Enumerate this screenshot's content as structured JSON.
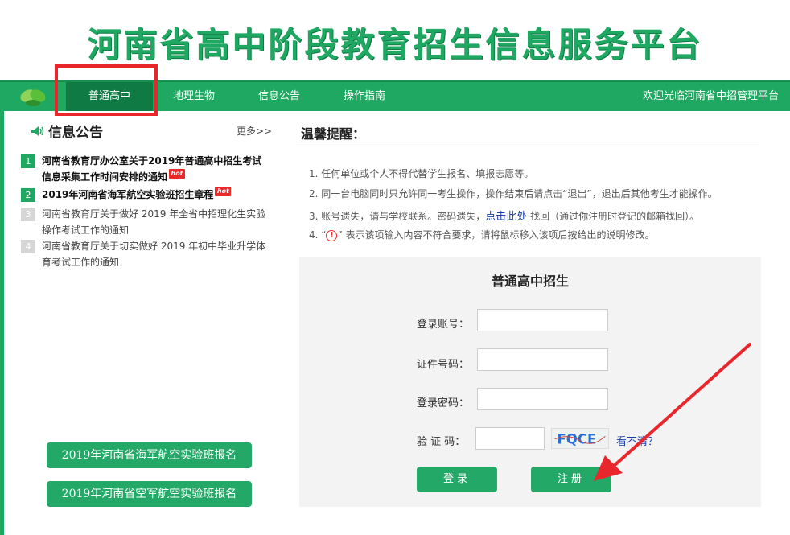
{
  "banner": {
    "title": "河南省高中阶段教育招生信息服务平台"
  },
  "nav": {
    "items": [
      {
        "label": "普通高中"
      },
      {
        "label": "地理生物"
      },
      {
        "label": "信息公告"
      },
      {
        "label": "操作指南"
      }
    ],
    "welcome": "欢迎光临河南省中招管理平台"
  },
  "news": {
    "title": "信息公告",
    "more": "更多>>",
    "hot_badge": "hot",
    "items": [
      {
        "num": "1",
        "text": "河南省教育厅办公室关于2019年普通高中招生考试信息采集工作时间安排的通知"
      },
      {
        "num": "2",
        "text": "2019年河南省海军航空实验班招生章程"
      },
      {
        "num": "3",
        "text": "河南省教育厅关于做好 2019 年全省中招理化生实验操作考试工作的通知"
      },
      {
        "num": "4",
        "text": "河南省教育厅关于切实做好 2019 年初中毕业升学体育考试工作的通知"
      }
    ]
  },
  "side_buttons": [
    {
      "label": "2019年河南省海军航空实验班报名"
    },
    {
      "label": "2019年河南省空军航空实验班报名"
    }
  ],
  "tips": {
    "title": "温馨提醒：",
    "t1": "1.  任何单位或个人不得代替学生报名、填报志愿等。",
    "t2": "2.  同一台电脑同时只允许同一考生操作，操作结束后请点击“退出”，退出后其他考生才能操作。",
    "t3_pre": "3.  账号遗失，请与学校联系。密码遗失，",
    "t3_link": "点击此处",
    "t3_post": " 找回（通过你注册时登记的邮箱找回）。",
    "t4_pre": "4.  “",
    "t4_icon": "!",
    "t4_post": "” 表示该项输入内容不符合要求，请将鼠标移入该项后按给出的说明修改。"
  },
  "login": {
    "title": "普通高中招生",
    "account_label": "登录账号：",
    "id_label": "证件号码：",
    "password_label": "登录密码：",
    "captcha_label": "验 证 码：",
    "captcha_text": "FQCE",
    "unclear": "看不清？",
    "login_btn": "登录",
    "register_btn": "注册"
  },
  "colors": {
    "brand_green": "#1fa861",
    "dark_green": "#0f7a43",
    "highlight_red": "#e8262c"
  }
}
